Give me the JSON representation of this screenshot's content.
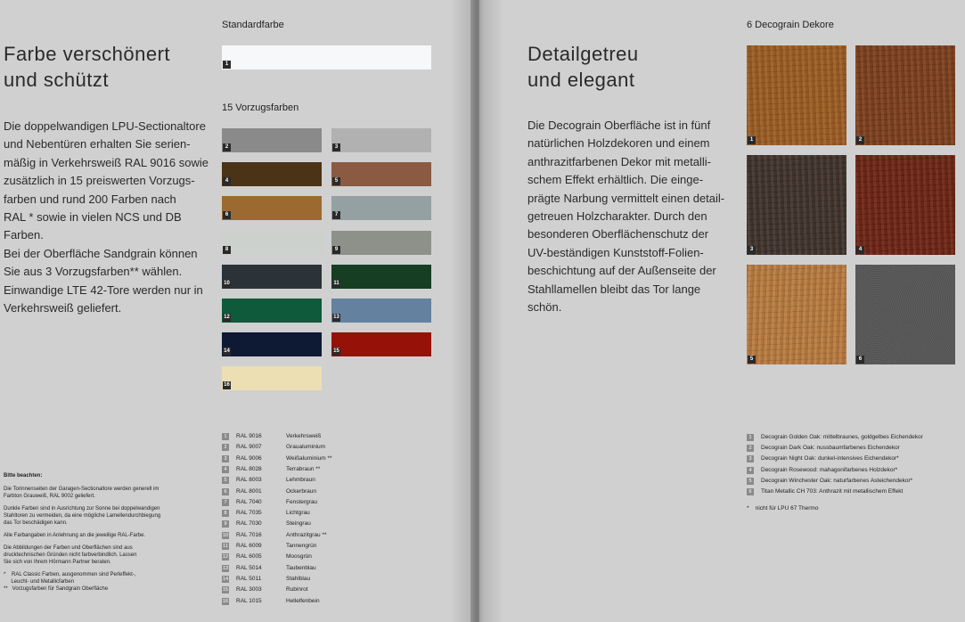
{
  "left": {
    "title_lines": [
      "Farbe verschönert",
      "und schützt"
    ],
    "body_lines": [
      "Die doppelwandigen LPU-Sectionaltore",
      "und Nebentüren erhalten Sie serien-",
      "mäßig in Verkehrsweiß RAL 9016 sowie",
      "zusätzlich in 15 preiswerten Vorzugs-",
      "farben und rund 200 Farben nach",
      "RAL * sowie in vielen NCS und DB",
      "Farben.",
      "Bei der Oberfläche Sandgrain können",
      "Sie aus 3 Vorzugsfarben** wählen.",
      "Einwandige LTE 42-Tore werden nur in",
      "Verkehrsweiß geliefert."
    ],
    "standard_heading": "Standardfarbe",
    "standard_swatch": {
      "num": "1",
      "color": "#f7f8fa"
    },
    "preferred_heading": "15 Vorzugsfarben",
    "swatches": [
      {
        "num": "2",
        "color": "#8a8a8a"
      },
      {
        "num": "3",
        "color": "#b2b1b2"
      },
      {
        "num": "4",
        "color": "#4b3318"
      },
      {
        "num": "5",
        "color": "#8a5a42"
      },
      {
        "num": "6",
        "color": "#9c6a30"
      },
      {
        "num": "7",
        "color": "#94a0a2"
      },
      {
        "num": "8",
        "color": "#ccd1cd"
      },
      {
        "num": "9",
        "color": "#8e918a"
      },
      {
        "num": "10",
        "color": "#2b3338"
      },
      {
        "num": "11",
        "color": "#153e22"
      },
      {
        "num": "12",
        "color": "#0e5a3a"
      },
      {
        "num": "13",
        "color": "#6482a0"
      },
      {
        "num": "14",
        "color": "#0e1a34"
      },
      {
        "num": "15",
        "color": "#961208"
      },
      {
        "num": "16",
        "color": "#eddfb4"
      }
    ],
    "legend": [
      {
        "num": "1",
        "code": "RAL 9016",
        "name": "Verkehrsweiß"
      },
      {
        "num": "2",
        "code": "RAL 9007",
        "name": "Graualuminium"
      },
      {
        "num": "3",
        "code": "RAL 9006",
        "name": "Weißaluminium **"
      },
      {
        "num": "4",
        "code": "RAL 8028",
        "name": "Terrabraun **"
      },
      {
        "num": "5",
        "code": "RAL 8003",
        "name": "Lehmbraun"
      },
      {
        "num": "6",
        "code": "RAL 8001",
        "name": "Ockerbraun"
      },
      {
        "num": "7",
        "code": "RAL 7040",
        "name": "Fenstergrau"
      },
      {
        "num": "8",
        "code": "RAL 7035",
        "name": "Lichtgrau"
      },
      {
        "num": "9",
        "code": "RAL 7030",
        "name": "Steingrau"
      },
      {
        "num": "10",
        "code": "RAL 7016",
        "name": "Anthrazitgrau **"
      },
      {
        "num": "11",
        "code": "RAL 6009",
        "name": "Tannengrün"
      },
      {
        "num": "12",
        "code": "RAL 6005",
        "name": "Moosgrün"
      },
      {
        "num": "13",
        "code": "RAL 5014",
        "name": "Taubenblau"
      },
      {
        "num": "14",
        "code": "RAL 5011",
        "name": "Stahlblau"
      },
      {
        "num": "15",
        "code": "RAL 3003",
        "name": "Rubinrot"
      },
      {
        "num": "16",
        "code": "RAL 1015",
        "name": "Hellelfenbein"
      }
    ],
    "notes": {
      "heading": "Bitte beachten:",
      "paragraphs": [
        [
          "Die Torinnenseiten der Garagen-Sectionaltore werden generell im",
          "Farbton Grauweiß, RAL 9002 geliefert."
        ],
        [
          "Dunkle Farben sind in Ausrichtung zur Sonne bei doppelwandigen",
          "Stahltoren zu vermeiden, da eine mögliche Lamellendurchbiegung",
          "das Tor beschädigen kann."
        ],
        [
          "Alle Farbangaben in Anlehnung an die jeweilige RAL-Farbe."
        ],
        [
          "Die Abbildungen der Farben und Oberflächen sind aus",
          "drucktechnischen Gründen nicht farbverbindlich. Lassen",
          "Sie sich von Ihrem Hörmann Partner beraten."
        ],
        [
          "*    RAL Classic Farben, ausgenommen sind Perleffekt-,",
          "     Leucht- und Metallicfarben",
          "**   Vorzugsfarben für Sandgrain Oberfläche"
        ]
      ]
    }
  },
  "right": {
    "title_lines": [
      "Detailgetreu",
      "und elegant"
    ],
    "body_lines": [
      "Die Decograin Oberfläche ist in fünf",
      "natürlichen Holzdekoren und einem",
      "anthrazitfarbenen Dekor mit metalli-",
      "schem Effekt erhältlich. Die einge-",
      "prägte Narbung vermittelt einen detail-",
      "getreuen Holzcharakter. Durch den",
      "besonderen Oberflächenschutz der",
      "UV-beständigen Kunststoff-Folien-",
      "beschichtung auf der Außenseite der",
      "Stahllamellen bleibt das Tor lange",
      "schön."
    ],
    "decor_heading": "6 Decograin Dekore",
    "decors": [
      {
        "num": "1",
        "color": "#9a5a1e"
      },
      {
        "num": "2",
        "color": "#7a3c18"
      },
      {
        "num": "3",
        "color": "#3c2f28"
      },
      {
        "num": "4",
        "color": "#6a2010"
      },
      {
        "num": "5",
        "color": "#b8783c"
      },
      {
        "num": "6",
        "color": "#555555"
      }
    ],
    "legend": [
      {
        "num": "1",
        "text": "Decograin Golden Oak: mittelbraunes, goldgelbes Eichendekor"
      },
      {
        "num": "2",
        "text": "Decograin Dark Oak: nussbaumfarbenes Eichendekor"
      },
      {
        "num": "3",
        "text": "Decograin Night Oak: dunkel-intensives Eichendekor*"
      },
      {
        "num": "4",
        "text": "Decograin Rosewood: mahagonifarbenes Holzdekor*"
      },
      {
        "num": "5",
        "text": "Decograin Winchester Oak: naturfarbenes Asteichendekor*"
      },
      {
        "num": "6",
        "text": "Titan Metallic CH 703: Anthrazit mit metallischem Effekt"
      }
    ],
    "footnote": "*    nicht für LPU 67 Thermo"
  }
}
